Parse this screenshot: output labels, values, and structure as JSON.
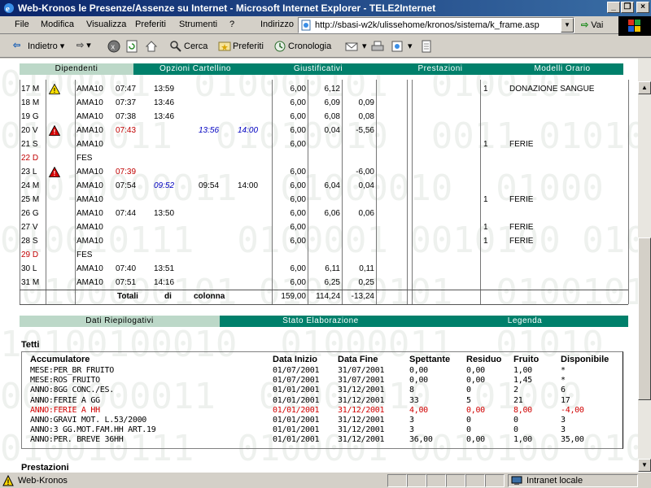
{
  "window": {
    "title": "Web-Kronos le Presenze/Assenze su Internet - Microsoft Internet Explorer - TELE2Internet",
    "minimize": "_",
    "restore": "❐",
    "close": "×"
  },
  "menu": [
    "File",
    "Modifica",
    "Visualizza",
    "Preferiti",
    "Strumenti",
    "?"
  ],
  "address": {
    "label": "Indirizzo",
    "url": "http://sbasi-w2k/ulissehome/kronos/sistema/k_frame.asp",
    "go": "Vai"
  },
  "toolbar": {
    "back": "Indietro",
    "search": "Cerca",
    "favorites": "Preferiti",
    "history": "Cronologia"
  },
  "top_tabs": [
    "Dipendenti",
    "Opzioni Cartellino",
    "Giustificativi",
    "Prestazioni",
    "Modelli Orario"
  ],
  "days": [
    {
      "day": "17 M",
      "code": "AMA10",
      "t1": "07:47",
      "t2": "13:59",
      "t3": "",
      "t4": "",
      "h": "6,00",
      "w": "6,12",
      "d": "",
      "n": "1",
      "note": "DONAZIONE SANGUE",
      "warn": "yellow"
    },
    {
      "day": "18 M",
      "code": "AMA10",
      "t1": "07:37",
      "t2": "13:46",
      "t3": "",
      "t4": "",
      "h": "6,00",
      "w": "6,09",
      "d": "0,09",
      "n": "",
      "note": ""
    },
    {
      "day": "19 G",
      "code": "AMA10",
      "t1": "07:38",
      "t2": "13:46",
      "t3": "",
      "t4": "",
      "h": "6,00",
      "w": "6,08",
      "d": "0,08",
      "n": "",
      "note": ""
    },
    {
      "day": "20 V",
      "code": "AMA10",
      "t1": "07:43",
      "t2": "",
      "t3": "13:56",
      "t4": "14:00",
      "h": "6,00",
      "w": "0,04",
      "d": "-5,56",
      "n": "",
      "note": "",
      "warn": "red",
      "t1red": true,
      "t3blue": true,
      "t4blue": true
    },
    {
      "day": "21 S",
      "code": "AMA10",
      "t1": "",
      "t2": "",
      "t3": "",
      "t4": "",
      "h": "6,00",
      "w": "",
      "d": "",
      "n": "1",
      "note": "FERIE"
    },
    {
      "day": "22 D",
      "code": "FES",
      "t1": "",
      "t2": "",
      "t3": "",
      "t4": "",
      "h": "",
      "w": "",
      "d": "",
      "n": "",
      "note": "",
      "dayred": true
    },
    {
      "day": "23 L",
      "code": "AMA10",
      "t1": "07:39",
      "t2": "",
      "t3": "",
      "t4": "",
      "h": "6,00",
      "w": "",
      "d": "-6,00",
      "n": "",
      "note": "",
      "warn": "red",
      "t1red": true
    },
    {
      "day": "24 M",
      "code": "AMA10",
      "t1": "07:54",
      "t2": "09:52",
      "t3": "09:54",
      "t4": "14:00",
      "h": "6,00",
      "w": "6,04",
      "d": "0,04",
      "n": "",
      "note": "",
      "t2blue": true
    },
    {
      "day": "25 M",
      "code": "AMA10",
      "t1": "",
      "t2": "",
      "t3": "",
      "t4": "",
      "h": "6,00",
      "w": "",
      "d": "",
      "n": "1",
      "note": "FERIE"
    },
    {
      "day": "26 G",
      "code": "AMA10",
      "t1": "07:44",
      "t2": "13:50",
      "t3": "",
      "t4": "",
      "h": "6,00",
      "w": "6,06",
      "d": "0,06",
      "n": "",
      "note": ""
    },
    {
      "day": "27 V",
      "code": "AMA10",
      "t1": "",
      "t2": "",
      "t3": "",
      "t4": "",
      "h": "6,00",
      "w": "",
      "d": "",
      "n": "1",
      "note": "FERIE"
    },
    {
      "day": "28 S",
      "code": "AMA10",
      "t1": "",
      "t2": "",
      "t3": "",
      "t4": "",
      "h": "6,00",
      "w": "",
      "d": "",
      "n": "1",
      "note": "FERIE"
    },
    {
      "day": "29 D",
      "code": "FES",
      "t1": "",
      "t2": "",
      "t3": "",
      "t4": "",
      "h": "",
      "w": "",
      "d": "",
      "n": "",
      "note": "",
      "dayred": true
    },
    {
      "day": "30 L",
      "code": "AMA10",
      "t1": "07:40",
      "t2": "13:51",
      "t3": "",
      "t4": "",
      "h": "6,00",
      "w": "6,11",
      "d": "0,11",
      "n": "",
      "note": ""
    },
    {
      "day": "31 M",
      "code": "AMA10",
      "t1": "07:51",
      "t2": "14:16",
      "t3": "",
      "t4": "",
      "h": "6,00",
      "w": "6,25",
      "d": "0,25",
      "n": "",
      "note": ""
    }
  ],
  "totals": {
    "label1": "Totali",
    "label2": "di",
    "label3": "colonna",
    "h": "159,00",
    "w": "114,24",
    "d": "-13,24"
  },
  "bottom_tabs": [
    "Dati Riepilogativi",
    "Stato Elaborazione",
    "Legenda"
  ],
  "tetti": {
    "title": "Tetti",
    "headers": [
      "Accumulatore",
      "Data Inizio",
      "Data Fine",
      "Spettante",
      "Residuo",
      "Fruito",
      "Disponibile"
    ],
    "rows": [
      [
        "MESE:PER_BR FRUITO",
        "01/07/2001",
        "31/07/2001",
        "0,00",
        "0,00",
        "1,00",
        "*"
      ],
      [
        "MESE:ROS FRUITO",
        "01/07/2001",
        "31/07/2001",
        "0,00",
        "0,00",
        "1,45",
        "*"
      ],
      [
        "ANNO:8GG CONC./ES.",
        "01/01/2001",
        "31/12/2001",
        "8",
        "0",
        "2",
        "6"
      ],
      [
        "ANNO:FERIE A GG",
        "01/01/2001",
        "31/12/2001",
        "33",
        "5",
        "21",
        "17"
      ],
      [
        "ANNO:FERIE A HH",
        "01/01/2001",
        "31/12/2001",
        "4,00",
        "0,00",
        "8,00",
        "-4,00"
      ],
      [
        "ANNO:GRAVI MOT. L.53/2000",
        "01/01/2001",
        "31/12/2001",
        "3",
        "0",
        "0",
        "3"
      ],
      [
        "ANNO:3 GG.MOT.FAM.HH ART.19",
        "01/01/2001",
        "31/12/2001",
        "3",
        "0",
        "0",
        "3"
      ],
      [
        "ANNO:PER. BREVE 36HH",
        "01/01/2001",
        "31/12/2001",
        "36,00",
        "0,00",
        "1,00",
        "35,00"
      ]
    ],
    "red_row": 4
  },
  "prestazioni_title": "Prestazioni",
  "status": {
    "left": "Web-Kronos",
    "zone": "Intranet locale"
  },
  "watermark": "0100001  010000101  0100101\n01000011  01010010  0011 01010\n 0010000011  01000010  01000\n010010111  0100001 0010100 01000\n 0100000101 010000101  0100101\n10100100010  01000011  01010\n0010000011  01000010  01000\n010010111  0100001 0010100 01000\n"
}
